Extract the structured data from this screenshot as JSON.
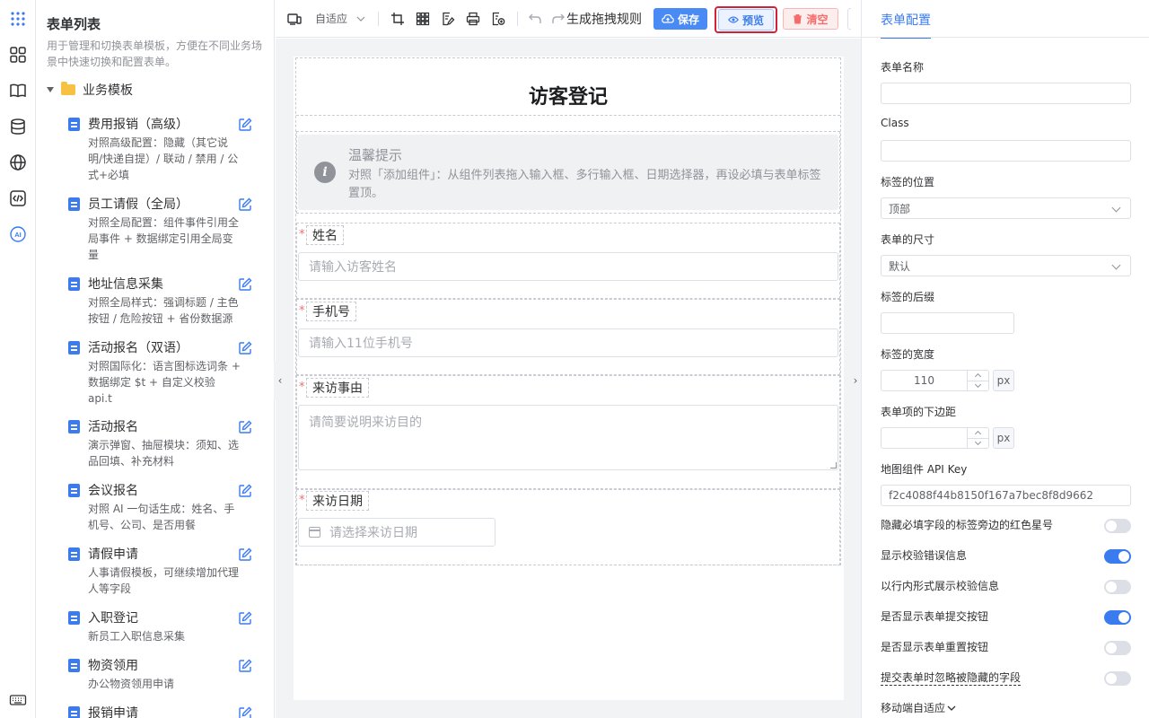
{
  "rail": {
    "icons": [
      "apps-grid-icon",
      "components-icon",
      "book-icon",
      "database-icon",
      "globe-icon",
      "code-icon",
      "ai-icon",
      "keyboard-icon"
    ],
    "ai_label": "AI"
  },
  "sidebar": {
    "title": "表单列表",
    "description": "用于管理和切换表单模板，方便在不同业务场景中快速切换和配置表单。",
    "group": "业务模板",
    "templates": [
      {
        "name": "费用报销（高级）",
        "desc": "对照高级配置：隐藏（其它说明/快递自提）/ 联动 / 禁用 / 公式+必填"
      },
      {
        "name": "员工请假（全局）",
        "desc": "对照全局配置：组件事件引用全局事件 + 数据绑定引用全局变量"
      },
      {
        "name": "地址信息采集",
        "desc": "对照全局样式：强调标题 / 主色按钮 / 危险按钮 + 省份数据源"
      },
      {
        "name": "活动报名（双语）",
        "desc": "对照国际化：语言图标选词条 + 数据绑定 $t + 自定义校验 api.t"
      },
      {
        "name": "活动报名",
        "desc": "演示弹窗、抽屉模块：须知、选品回填、补充材料"
      },
      {
        "name": "会议报名",
        "desc": "对照 AI 一句话生成：姓名、手机号、公司、是否用餐"
      },
      {
        "name": "请假申请",
        "desc": "人事请假模板，可继续增加代理人等字段"
      },
      {
        "name": "入职登记",
        "desc": "新员工入职信息采集"
      },
      {
        "name": "物资领用",
        "desc": "办公物资领用申请"
      },
      {
        "name": "报销申请",
        "desc": ""
      }
    ]
  },
  "toolbar": {
    "adaptive_label": "自适应",
    "generate_label": "生成拖拽规则",
    "save_label": "保存",
    "preview_label": "预览",
    "clear_label": "清空",
    "tooltip": "预览"
  },
  "form": {
    "title": "访客登记",
    "alert_title": "温馨提示",
    "alert_body": "对照「添加组件」：从组件列表拖入输入框、多行输入框、日期选择器，再设必填与表单标签置顶。",
    "fields": [
      {
        "label": "姓名",
        "placeholder": "请输入访客姓名"
      },
      {
        "label": "手机号",
        "placeholder": "请输入11位手机号"
      },
      {
        "label": "来访事由",
        "placeholder": "请简要说明来访目的"
      },
      {
        "label": "来访日期",
        "placeholder": "请选择来访日期"
      }
    ],
    "required_mark": "*"
  },
  "panel": {
    "tab": "表单配置",
    "form_name_label": "表单名称",
    "form_name_value": "",
    "class_label": "Class",
    "class_value": "",
    "label_position_label": "标签的位置",
    "label_position_value": "顶部",
    "form_size_label": "表单的尺寸",
    "form_size_value": "默认",
    "label_suffix_label": "标签的后缀",
    "label_suffix_value": "",
    "label_width_label": "标签的宽度",
    "label_width_value": "110",
    "label_width_unit": "px",
    "item_margin_label": "表单项的下边距",
    "item_margin_value": "",
    "item_margin_unit": "px",
    "map_key_label": "地图组件 API Key",
    "map_key_value": "f2c4088f44b8150f167a7bec8f8d9662",
    "switches": [
      {
        "label": "隐藏必填字段的标签旁边的红色星号",
        "on": false
      },
      {
        "label": "显示校验错误信息",
        "on": true
      },
      {
        "label": "以行内形式展示校验信息",
        "on": false
      },
      {
        "label": "是否显示表单提交按钮",
        "on": true
      },
      {
        "label": "是否显示表单重置按钮",
        "on": false
      },
      {
        "label": "提交表单时忽略被隐藏的字段",
        "on": false
      }
    ],
    "mobile_label": "移动端自适应"
  },
  "colors": {
    "primary": "#3a7cf0",
    "danger": "#f56c6c",
    "highlight": "#d0233b"
  }
}
